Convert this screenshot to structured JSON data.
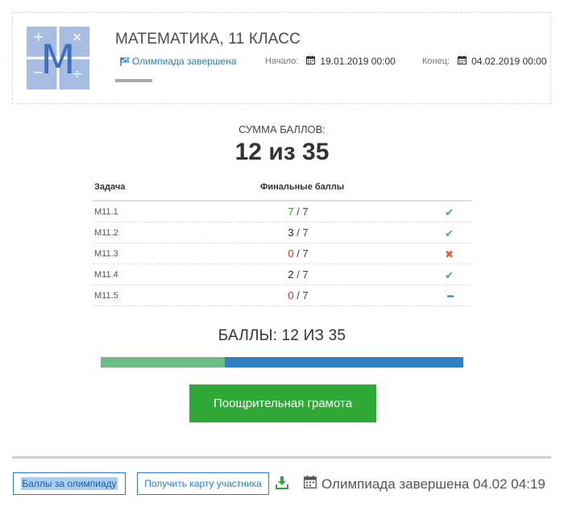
{
  "header": {
    "logo_letter": "M",
    "title": "МАТЕМАТИКА, 11 КЛАСС",
    "status_link": "Олимпиада завершена",
    "start_label": "Начало:",
    "start_value": "19.01.2019 00:00",
    "end_label": "Конец:",
    "end_value": "04.02.2019 00:00"
  },
  "summary": {
    "sum_label": "СУММА БАЛЛОВ:",
    "sum_value": "12 из 35"
  },
  "results": {
    "col_task": "Задача",
    "col_score": "Финальные баллы",
    "rows": [
      {
        "task": "М11.1",
        "score": "7",
        "max": "7",
        "status_icon": "check-icon"
      },
      {
        "task": "М11.2",
        "score": "3",
        "max": "7",
        "status_icon": "check-icon"
      },
      {
        "task": "М11.3",
        "score": "0",
        "max": "7",
        "status_icon": "cross-icon"
      },
      {
        "task": "М11.4",
        "score": "2",
        "max": "7",
        "status_icon": "check-icon"
      },
      {
        "task": "М11.5",
        "score": "0",
        "max": "7",
        "status_icon": "minus-icon"
      }
    ]
  },
  "points": {
    "label": "БАЛЛЫ: 12 ИЗ 35",
    "progress_fraction": 0.343
  },
  "award_button": "Поощрительная грамота",
  "footer": {
    "scores_button": "Баллы за олимпиаду",
    "card_button": "Получить карту участника",
    "download_icon": "download-icon",
    "final_status": "Олимпиада завершена 04.02 04:19"
  },
  "colors": {
    "accent": "#2a7fc2",
    "award_green": "#2ea836",
    "progress_fill": "#6dbb85",
    "progress_track": "#2f80c0"
  }
}
